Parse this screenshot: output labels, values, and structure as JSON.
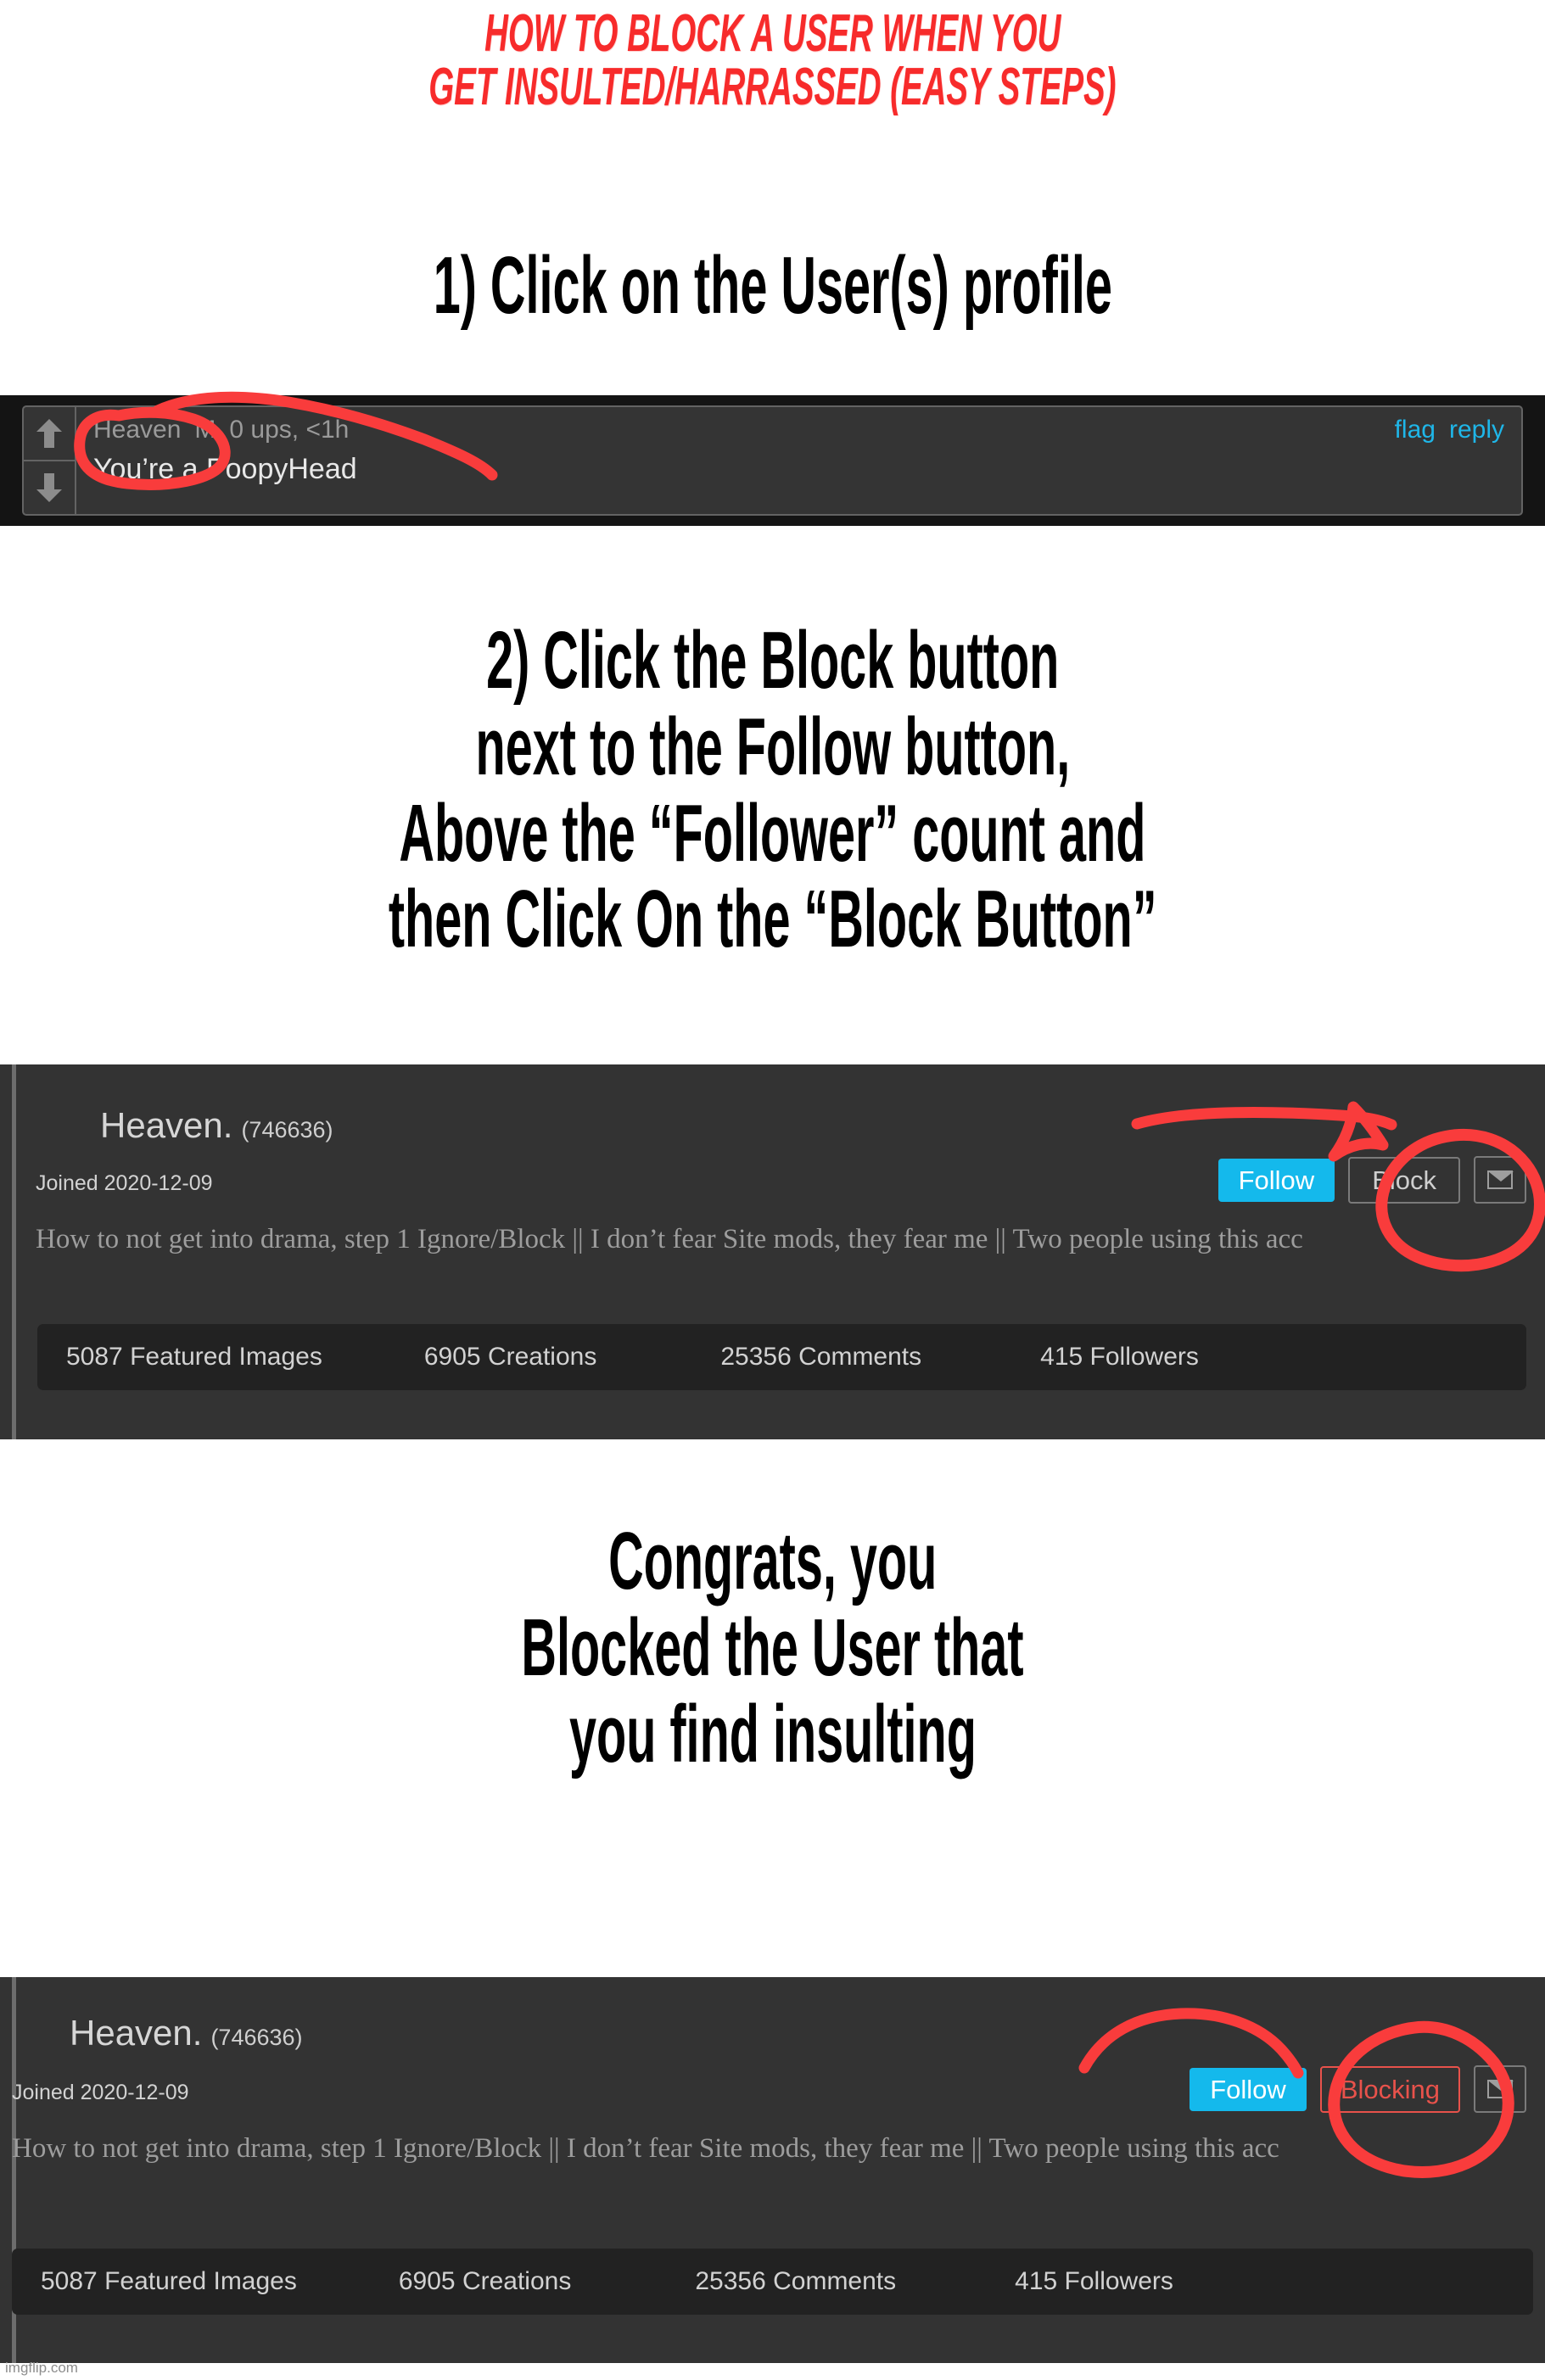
{
  "title": {
    "line1": "HOW TO BLOCK A USER WHEN YOU",
    "line2": "GET INSULTED/HARRASSED (EASY STEPS)",
    "color": "#F72B2B"
  },
  "step1": {
    "lines": [
      "1) Click on the User(s) profile"
    ]
  },
  "step2": {
    "lines": [
      "2) Click the Block button",
      "next to the Follow button,",
      "Above the “Follower” count and",
      "then Click On the “Block Button”"
    ]
  },
  "congrats": {
    "lines": [
      "Congrats, you",
      "Blocked the User that",
      "you find insulting"
    ]
  },
  "comment": {
    "upvote_icon": "arrow-up-icon",
    "downvote_icon": "arrow-down-icon",
    "username": "Heaven",
    "badge": "M",
    "stats": "0 ups, <1h",
    "text": "You’re a PoopyHead",
    "flag_label": "flag",
    "reply_label": "reply",
    "link_color": "#1FB6E8"
  },
  "profile_before": {
    "name": "Heaven.",
    "user_id": "(746636)",
    "joined": "Joined 2020-12-09",
    "bio": "How to not get into drama, step 1 Ignore/Block || I don’t fear Site mods, they fear me || Two people using this acc",
    "follow_label": "Follow",
    "block_label": "Block",
    "message_icon": "envelope-icon",
    "follow_color": "#14B9EC",
    "stats": [
      "5087 Featured Images",
      "6905 Creations",
      "25356 Comments",
      "415 Followers"
    ]
  },
  "profile_after": {
    "name": "Heaven.",
    "user_id": "(746636)",
    "joined": "Joined 2020-12-09",
    "bio": "How to not get into drama, step 1 Ignore/Block || I don’t fear Site mods, they fear me || Two people using this acc",
    "follow_label": "Follow",
    "block_label": "Blocking",
    "message_icon": "envelope-icon",
    "follow_color": "#14B9EC",
    "blocking_color": "#E8524B",
    "stats": [
      "5087 Featured Images",
      "6905 Creations",
      "25356 Comments",
      "415 Followers"
    ]
  },
  "annotations": {
    "ink_color": "#F93C3C",
    "marks": [
      "circle-around-username",
      "arrow-to-block-button",
      "circle-around-block-button",
      "arrow-to-blocking-button",
      "circle-around-blocking-button"
    ]
  },
  "watermark": "imgflip.com"
}
